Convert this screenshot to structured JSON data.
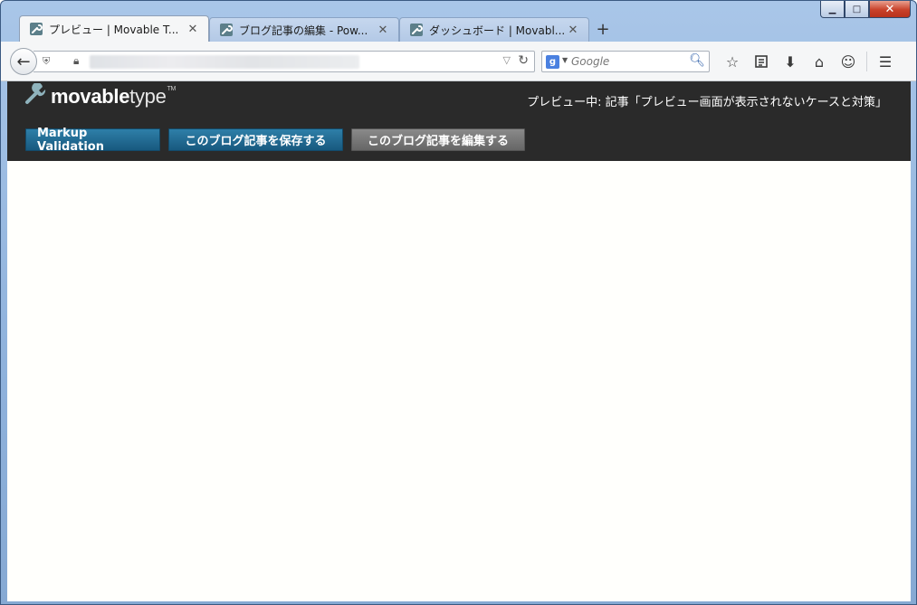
{
  "window": {
    "controls": {
      "minimize": "▁",
      "maximize": "□",
      "close": "✕"
    }
  },
  "tabs": [
    {
      "label": "プレビュー | Movable T...",
      "active": true,
      "close": "✕",
      "icon": "movabletype-favicon-icon"
    },
    {
      "label": "ブログ記事の編集 - Pow...",
      "active": false,
      "close": "✕",
      "icon": "movabletype-favicon-icon"
    },
    {
      "label": "ダッシュボード | Movabl...",
      "active": false,
      "close": "✕",
      "icon": "movabletype-favicon-icon"
    }
  ],
  "new_tab_label": "+",
  "navbar": {
    "back": "←",
    "search": {
      "engine": "g",
      "placeholder": "Google"
    }
  },
  "toolbar": {
    "icons": [
      "star-icon",
      "reading-list-icon",
      "download-icon",
      "home-icon",
      "hello-icon",
      "menu-icon"
    ]
  },
  "mt": {
    "logo_bold": "movable",
    "logo_light": "type",
    "tm": "TM",
    "preview_title": "プレビュー中: 記事「プレビュー画面が表示されないケースと対策」",
    "buttons": {
      "markup_validation": "Markup Validation",
      "save_entry": "このブログ記事を保存する",
      "edit_entry": "このブログ記事を編集する"
    }
  },
  "colors": {
    "header_bg": "#2a2a2a",
    "button_blue": "#1f6b93",
    "button_gray": "#777777"
  }
}
